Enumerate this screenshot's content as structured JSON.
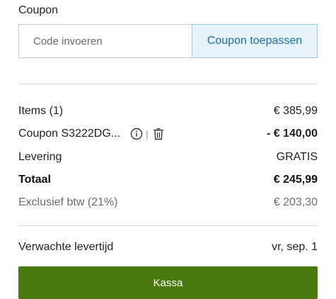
{
  "coupon": {
    "title": "Coupon",
    "placeholder": "Code invoeren",
    "apply_label": "Coupon toepassen"
  },
  "summary": {
    "items_label": "Items (1)",
    "items_value": "€ 385,99",
    "coupon_label": "Coupon S3222DG...",
    "coupon_value": "- € 140,00",
    "delivery_label": "Levering",
    "delivery_value": "GRATIS",
    "total_label": "Totaal",
    "total_value": "€ 245,99",
    "excl_label": "Exclusief btw (21%)",
    "excl_value": "€ 203,30",
    "eta_label": "Verwachte levertijd",
    "eta_value": "vr, sep. 1"
  },
  "checkout": {
    "label": "Kassa"
  },
  "colors": {
    "accent_green": "#4a7a0f",
    "discount_green": "#3f7a0c",
    "apply_blue": "#1a6fb0",
    "apply_bg": "#e6f3fb"
  },
  "icons": {
    "info": "info-icon",
    "delete": "trash-icon"
  }
}
